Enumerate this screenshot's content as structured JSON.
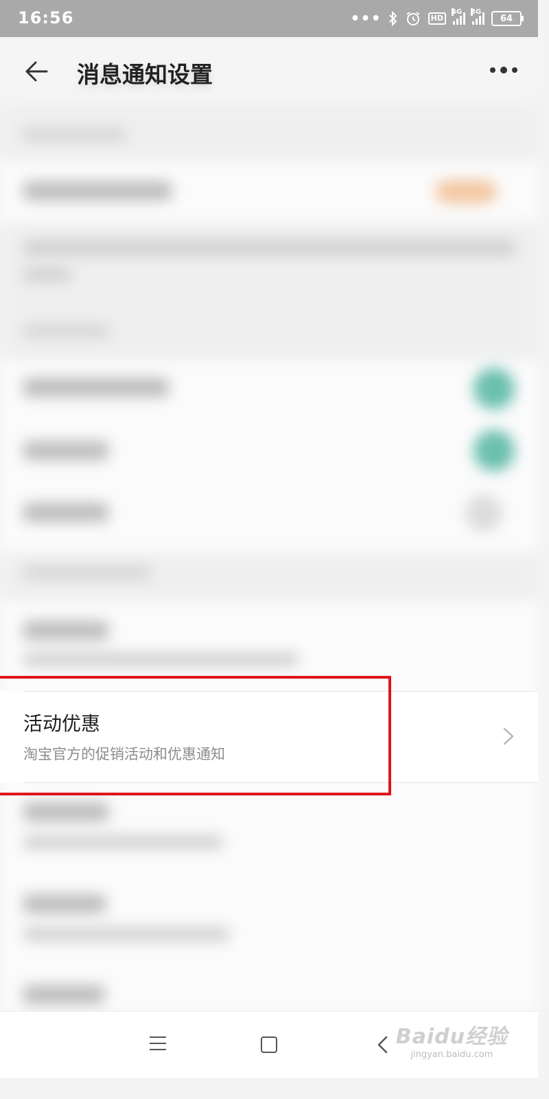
{
  "status_bar": {
    "time": "16:56",
    "icons": [
      "more-dots-icon",
      "bluetooth-icon",
      "alarm-icon",
      "hd-icon",
      "signal-4g-icon",
      "signal-3g-icon",
      "battery-icon"
    ],
    "hd_label": "HD",
    "signal1_label": "4G",
    "signal2_label": "3G",
    "battery_level": "64"
  },
  "header": {
    "title": "消息通知设置",
    "back_icon": "arrow-left-icon",
    "more_icon": "more-horizontal-icon"
  },
  "highlighted_item": {
    "title": "活动优惠",
    "subtitle": "淘宝官方的促销活动和优惠通知",
    "chevron_icon": "chevron-right-icon",
    "highlight_color": "#e0141b"
  },
  "nav_bar": {
    "icons": [
      "menu-icon",
      "home-square-icon",
      "back-chevron-icon"
    ]
  },
  "watermark": {
    "brand": "Baidu经验",
    "url": "jingyan.baidu.com"
  },
  "colors": {
    "status_bar_bg": "#a9a9a9",
    "page_bg": "#f4f4f4",
    "toggle_on": "#6bbfae"
  }
}
